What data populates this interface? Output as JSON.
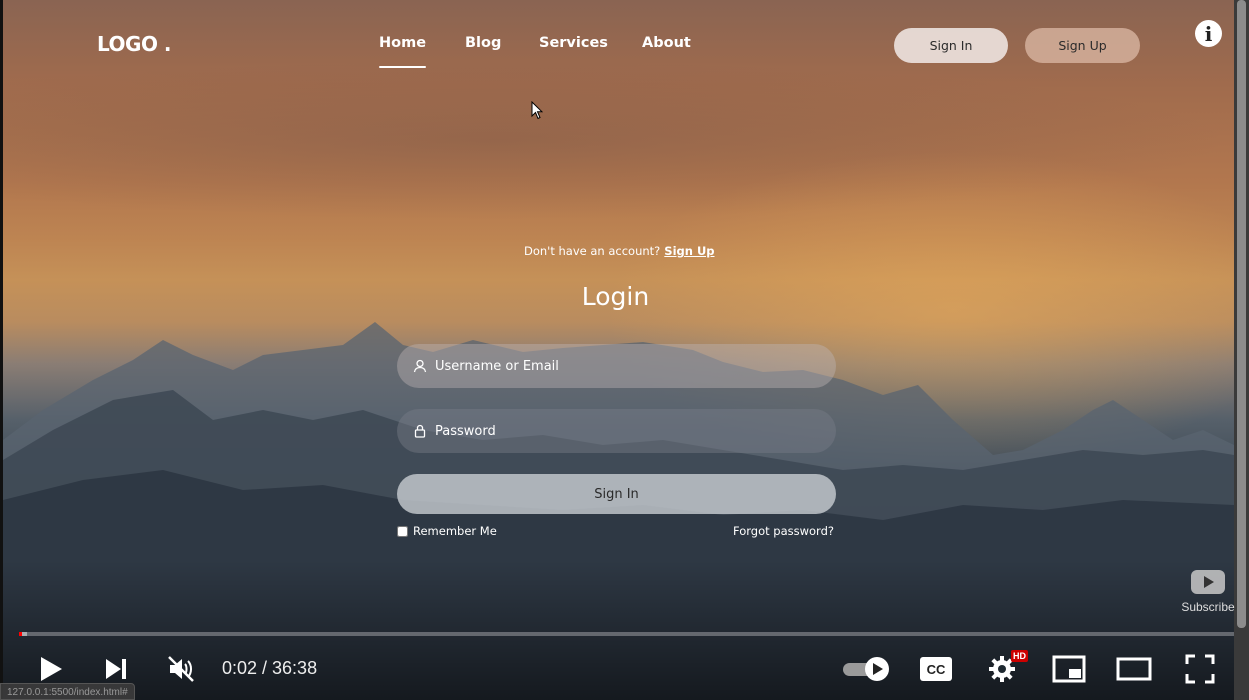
{
  "header": {
    "logo": "LOGO .",
    "nav": [
      {
        "label": "Home",
        "active": true
      },
      {
        "label": "Blog",
        "active": false
      },
      {
        "label": "Services",
        "active": false
      },
      {
        "label": "About",
        "active": false
      }
    ],
    "sign_in_label": "Sign In",
    "sign_up_label": "Sign Up",
    "info_label": "i"
  },
  "login": {
    "prompt_text": "Don't have an account?",
    "prompt_link": "Sign Up",
    "title": "Login",
    "username_placeholder": "Username or Email",
    "password_placeholder": "Password",
    "submit_label": "Sign In",
    "remember_label": "Remember Me",
    "forgot_label": "Forgot password?"
  },
  "overlay": {
    "subscribe_label": "Subscribe"
  },
  "player": {
    "current_time": "0:02",
    "duration": "36:38",
    "time_display": "0:02 / 36:38",
    "progress_fraction": 0.0009,
    "loaded_fraction": 0.005,
    "hd_badge": "HD",
    "cc_label": "CC",
    "autoplay_on": true,
    "muted": true
  },
  "status_bar": {
    "url": "127.0.0.1:5500/index.html#"
  },
  "colors": {
    "progress_played": "#ff0000",
    "hd_badge": "#cc0000"
  }
}
